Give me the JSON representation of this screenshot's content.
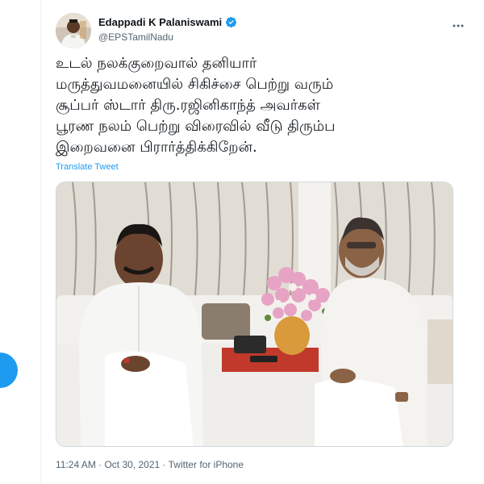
{
  "tweet": {
    "author": {
      "display_name": "Edappadi K Palaniswami",
      "handle": "@EPSTamilNadu",
      "verified": true,
      "avatar_icon": "profile-photo"
    },
    "more_icon": "more-horizontal-icon",
    "text_lines": [
      "உடல் நலக்குறைவால் தனியார்",
      "மருத்துவமனையில் சிகிச்சை பெற்று வரும்",
      "சூப்பர் ஸ்டார் திரு.ரஜினிகாந்த் அவர்கள்",
      "பூரண நலம் பெற்று விரைவில் வீடு திரும்ப",
      "இறைவனை பிரார்த்திக்கிறேன்."
    ],
    "translate_label": "Translate Tweet",
    "timestamp": "11:24 AM · Oct 30, 2021",
    "separator": " · ",
    "source": "Twitter for iPhone"
  },
  "colors": {
    "accent": "#1d9bf0",
    "text_primary": "#0f1419",
    "text_secondary": "#536471",
    "border": "#cfd9de"
  }
}
